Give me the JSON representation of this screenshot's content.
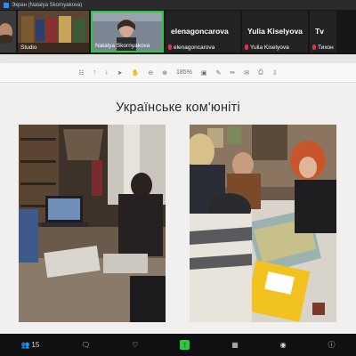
{
  "window": {
    "title": "Экран (Natalya Skornyakova)"
  },
  "gallery": {
    "tiles": [
      {
        "name": ""
      },
      {
        "name": "Studio"
      },
      {
        "name": "Natalya Skornyakova"
      },
      {
        "big_name": "elenagoncarova",
        "name": "elenagoncarova"
      },
      {
        "big_name": "Yulia Kiselyova",
        "name": "Yulia Kiselyova"
      },
      {
        "big_name": "Tv",
        "name": "Тихон"
      }
    ]
  },
  "viewer": {
    "doc_title": "...",
    "zoom": "185%"
  },
  "slide": {
    "title": "Українське ком'юніті"
  },
  "bottombar": {
    "participants_count": "15"
  },
  "colors": {
    "active_speaker": "#27c93f",
    "muted": "#e0363b",
    "zoom_blue": "#2d8cff"
  }
}
